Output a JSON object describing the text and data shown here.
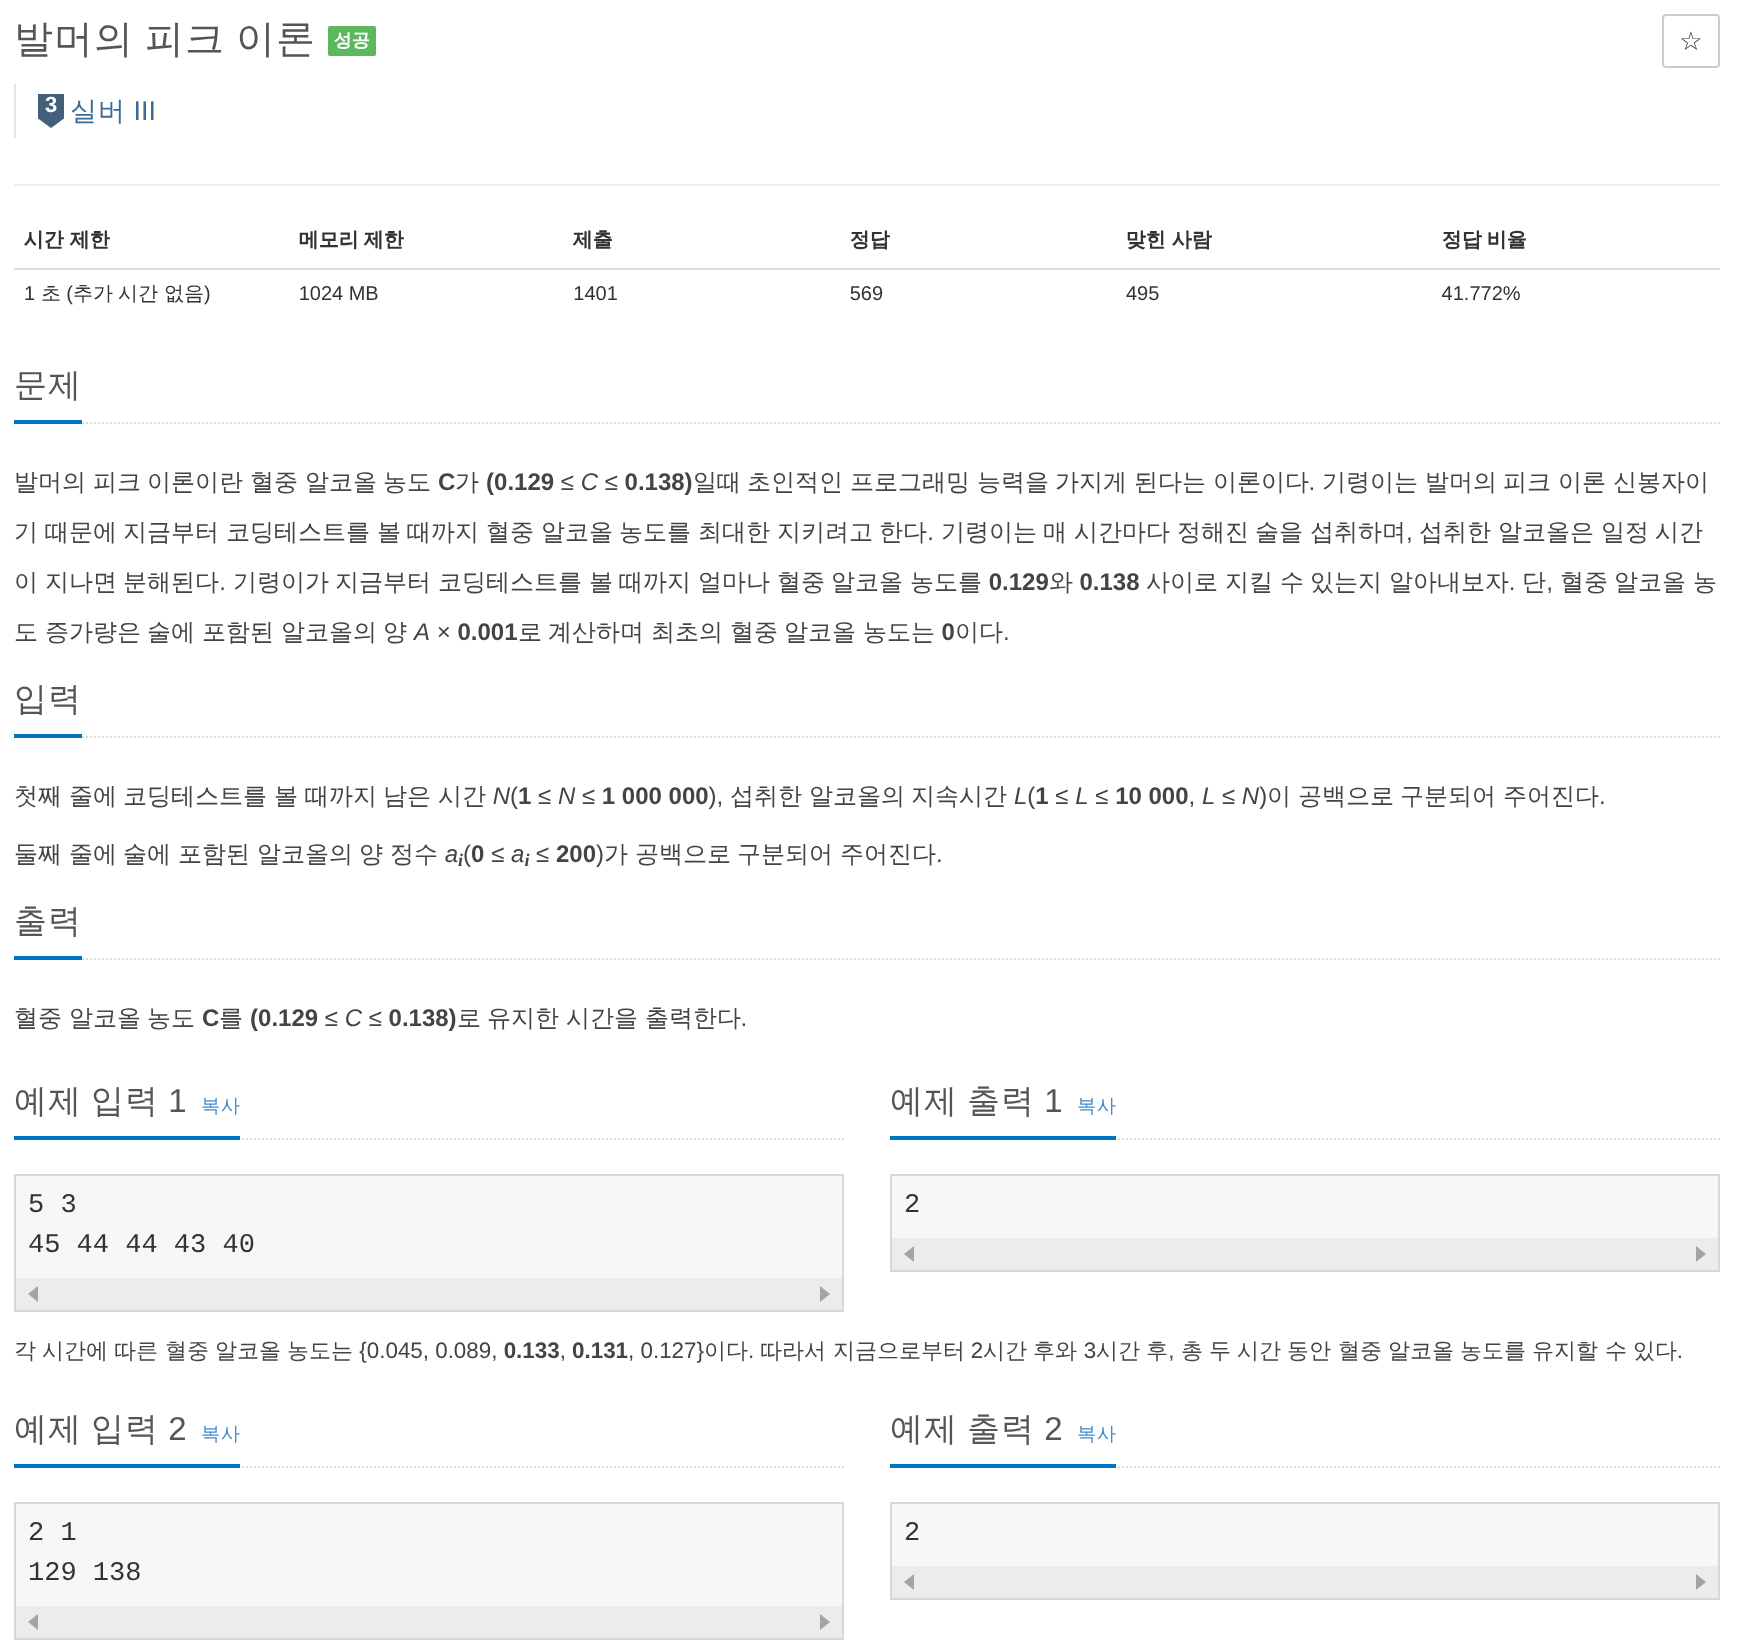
{
  "problem": {
    "title": "발머의 피크 이론",
    "result_badge": "성공",
    "star_button": "☆"
  },
  "tier": {
    "badge_number": "3",
    "label": "실버 III"
  },
  "limits_table": {
    "columns": [
      "시간 제한",
      "메모리 제한",
      "제출",
      "정답",
      "맞힌 사람",
      "정답 비율"
    ],
    "rows": [
      [
        "1 초 (추가 시간 없음)",
        "1024 MB",
        "1401",
        "569",
        "495",
        "41.772%"
      ]
    ]
  },
  "sections": [
    {
      "heading": "문제",
      "paragraphs": [
        "발머의 피크 이론이란 혈중 알코올 농도 **C**가 **(0.129** ≤ *C* ≤ **0.138)**일때 초인적인 프로그래밍 능력을 가지게 된다는 이론이다. 기령이는 발머의 피크 이론 신봉자이기 때문에 지금부터 코딩테스트를 볼 때까지 혈중 알코올 농도를 최대한 지키려고 한다. 기령이는 매 시간마다 정해진 술을 섭취하며, 섭취한 알코올은 일정 시간이 지나면 분해된다. 기령이가 지금부터 코딩테스트를 볼 때까지 얼마나 혈중 알코올 농도를 **0.129**와 **0.138** 사이로 지킬 수 있는지 알아내보자. 단, 혈중 알코올 농도 증가량은 술에 포함된 알코올의 양 *A* × **0.001**로 계산하며 최초의 혈중 알코올 농도는 **0**이다."
      ]
    },
    {
      "heading": "입력",
      "paragraphs": [
        "첫째 줄에 코딩테스트를 볼 때까지 남은 시간 *N*(**1** ≤ *N* ≤ **1 000 000**), 섭취한 알코올의 지속시간 *L*(**1** ≤ *L* ≤ **10 000**, *L* ≤ *N*)이 공백으로 구분되어 주어진다.",
        "둘째 줄에 술에 포함된 알코올의 양 정수 *a*$_{i}$(**0** ≤ *a*$_{i}$ ≤ **200**)가 공백으로 구분되어 주어진다."
      ]
    },
    {
      "heading": "출력",
      "paragraphs": [
        "혈중 알코올 농도 **C**를 **(0.129** ≤ *C* ≤ **0.138)**로 유지한 시간을 출력한다."
      ]
    }
  ],
  "examples": [
    {
      "input": {
        "heading": "예제 입력 1",
        "copy_link": "복사",
        "text": "5 3\n45 44 44 43 40"
      },
      "output": {
        "heading": "예제 출력 1",
        "copy_link": "복사",
        "text": "2"
      },
      "note": "각 시간에 따른 혈중 알코올 농도는 {0.045, 0.089, **0.133**, **0.131**, 0.127}이다. 따라서 지금으로부터 2시간 후와 3시간 후, 총 두 시간 동안 혈중 알코올 농도를 유지할 수 있다."
    },
    {
      "input": {
        "heading": "예제 입력 2",
        "copy_link": "복사",
        "text": "2 1\n129 138"
      },
      "output": {
        "heading": "예제 출력 2",
        "copy_link": "복사",
        "text": "2"
      }
    }
  ]
}
